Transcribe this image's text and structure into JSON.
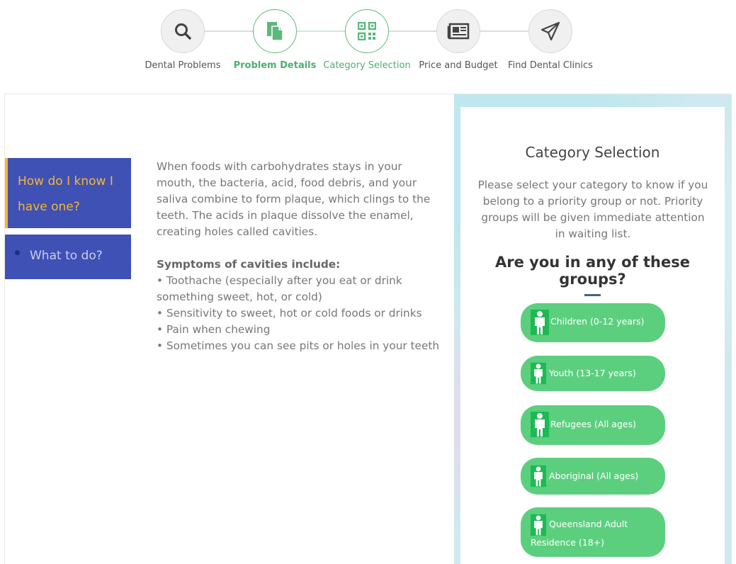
{
  "steps": [
    {
      "label": "Dental Problems",
      "icon": "search-icon",
      "state": "pending"
    },
    {
      "label": "Problem Details",
      "icon": "document-icon",
      "state": "done"
    },
    {
      "label": "Category Selection",
      "icon": "qr-code-icon",
      "state": "active"
    },
    {
      "label": "Price and Budget",
      "icon": "newspaper-icon",
      "state": "pending"
    },
    {
      "label": "Find Dental Clinics",
      "icon": "paper-plane-icon",
      "state": "pending"
    }
  ],
  "tabs": {
    "active": "How do I know I have one?",
    "inactive": "What to do?"
  },
  "description": {
    "paragraph": "When foods with carbohydrates stays in your mouth, the bacteria, acid, food debris, and your saliva combine to form plaque, which clings to the teeth. The acids in plaque dissolve the enamel, creating holes called cavities.",
    "symptoms_title": "Symptoms of cavities include:",
    "symptoms": [
      "• Toothache (especially after you eat or drink something sweet, hot, or cold)",
      "• Sensitivity to sweet, hot or cold foods or drinks",
      "• Pain when chewing",
      "• Sometimes you can see pits or holes in your teeth"
    ]
  },
  "panel": {
    "title": "Category Selection",
    "description": "Please select your category to know if you belong to a priority group or not. Priority groups will be given immediate attention in waiting list.",
    "question": "Are you in any of these groups?",
    "groups": [
      "Children (0-12 years)",
      "Youth (13-17 years)",
      "Refugees (All ages)",
      "Aboriginal (All ages)",
      "Queensland Adult Residence (18+)"
    ]
  },
  "colors": {
    "accent_green": "#5ccf7f",
    "tab_blue": "#3f51b5",
    "tab_highlight": "#f5b731"
  }
}
